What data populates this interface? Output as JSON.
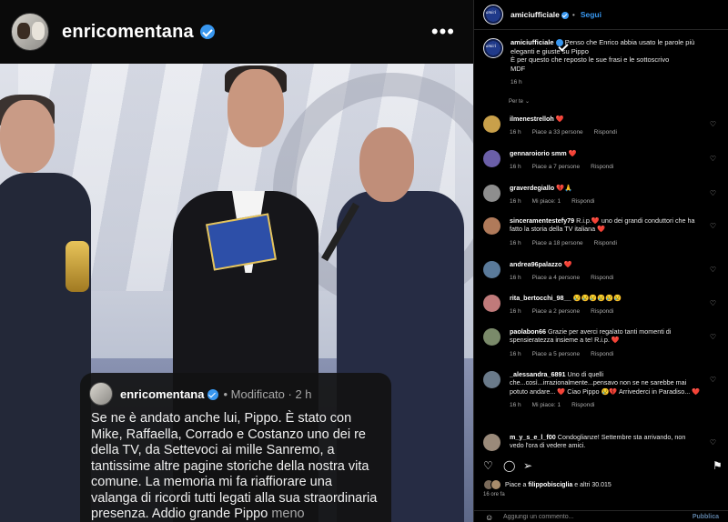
{
  "story": {
    "username": "enricomentana",
    "more_icon": "•••"
  },
  "caption": {
    "username": "enricomentana",
    "meta": "• Modificato · 2 h",
    "text": "Se ne è andato anche lui, Pippo. È stato con Mike, Raffaella, Corrado e Costanzo uno dei re della TV, da Settevoci ai mille Sanremo, a tantissime altre pagine storiche della nostra vita comune. La memoria mi fa riaffiorare una valanga di ricordi tutti legati alla sua straordinaria presenza. Addio grande Pippo",
    "more": "meno"
  },
  "panel": {
    "username": "amiciufficiale",
    "separator": "•",
    "follow_label": "Segui",
    "post": {
      "username": "amiciufficiale",
      "text": "Penso che Enrico abbia usato le parole più eleganti e giuste su Pippo",
      "text2": "È per questo che reposto le sue frasi e le sottoscrivo",
      "signature": "MDF",
      "time": "16 h"
    },
    "for_you": "Per te",
    "comments": [
      {
        "user": "ilmenestrelloh",
        "text": "❤️",
        "time": "16 h",
        "likes": "Piace a 33 persone",
        "reply": "Rispondi",
        "avatar_color": "#c9a04a"
      },
      {
        "user": "gennaroiorio smm",
        "text": "❤️",
        "time": "16 h",
        "likes": "Piace a 7 persone",
        "reply": "Rispondi",
        "avatar_color": "#6b5fa8"
      },
      {
        "user": "graverdegiallo",
        "text": "💔🙏",
        "time": "16 h",
        "likes": "Mi piace: 1",
        "reply": "Rispondi",
        "avatar_color": "#8e8e8e"
      },
      {
        "user": "sinceramentestefy79",
        "text": "R.i.p.❤️ uno dei grandi conduttori che ha fatto la storia della TV italiana ❤️",
        "time": "16 h",
        "likes": "Piace a 18 persone",
        "reply": "Rispondi",
        "avatar_color": "#b07a5a"
      },
      {
        "user": "andrea96palazzo",
        "text": "❤️",
        "time": "16 h",
        "likes": "Piace a 4 persone",
        "reply": "Rispondi",
        "avatar_color": "#5a7a9a"
      },
      {
        "user": "rita_bertocchi_98__",
        "text": "😢😢😢😢😢😢",
        "time": "16 h",
        "likes": "Piace a 2 persone",
        "reply": "Rispondi",
        "avatar_color": "#c07a7a"
      },
      {
        "user": "paolabon66",
        "text": "Grazie per averci regalato tanti momenti di spensieratezza insieme a te! R.i.p. ❤️",
        "time": "16 h",
        "likes": "Piace a 5 persone",
        "reply": "Rispondi",
        "avatar_color": "#7a8a6a"
      },
      {
        "user": "_alessandra_6891",
        "text": "Uno di quelli che...così...irrazionalmente...pensavo non se ne sarebbe mai potuto andare... ❤️ Ciao Pippo 😢💔 Arrivederci in Paradiso... ❤️",
        "time": "16 h",
        "likes": "Mi piace: 1",
        "reply": "Rispondi",
        "avatar_color": "#6a7a8a"
      },
      {
        "user": "m_y_s_e_l_f00",
        "text": "Condoglianze! Settembre sta arrivando, non vedo l'ora di vedere amici.",
        "time": "",
        "likes": "",
        "reply": "",
        "avatar_color": "#9a8a7a"
      }
    ],
    "likes_line_prefix": "Piace a",
    "likes_line_user": "filippobisciglia",
    "likes_line_suffix": "e altri 30.015",
    "post_age": "16 ore fa",
    "add_comment_placeholder": "Aggiungi un commento...",
    "publish_label": "Pubblica"
  }
}
